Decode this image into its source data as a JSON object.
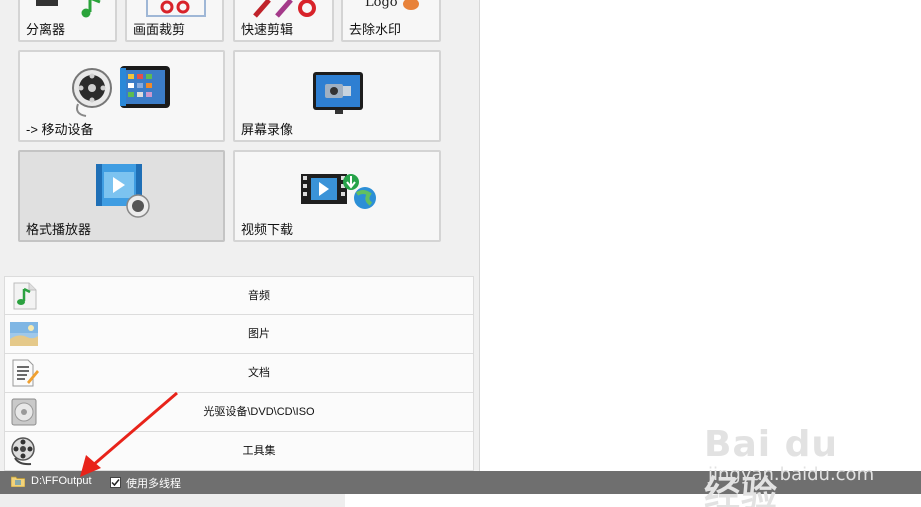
{
  "tiles": {
    "splitter": "分离器",
    "crop": "画面裁剪",
    "quick_cut": "快速剪辑",
    "remove_watermark": "去除水印",
    "logo_text": "Logo",
    "mobile": "-> 移动设备",
    "screen_record": "屏幕录像",
    "format_player": "格式播放器",
    "video_download": "视频下载"
  },
  "categories": [
    {
      "label": "音频",
      "icon": "music-note-icon"
    },
    {
      "label": "图片",
      "icon": "picture-icon"
    },
    {
      "label": "文档",
      "icon": "document-icon"
    },
    {
      "label": "光驱设备\\DVD\\CD\\ISO",
      "icon": "disc-icon"
    },
    {
      "label": "工具集",
      "icon": "film-reel-icon"
    }
  ],
  "status": {
    "output_path": "D:\\FFOutput",
    "multithread_label": "使用多线程",
    "multithread_checked": true
  },
  "watermark": {
    "main": "Bai du 经验",
    "sub": "jingyan.baidu.com"
  },
  "colors": {
    "statusbar": "#6f6f6f",
    "arrow": "#e8231a",
    "tile_border": "#d4d4d4"
  }
}
